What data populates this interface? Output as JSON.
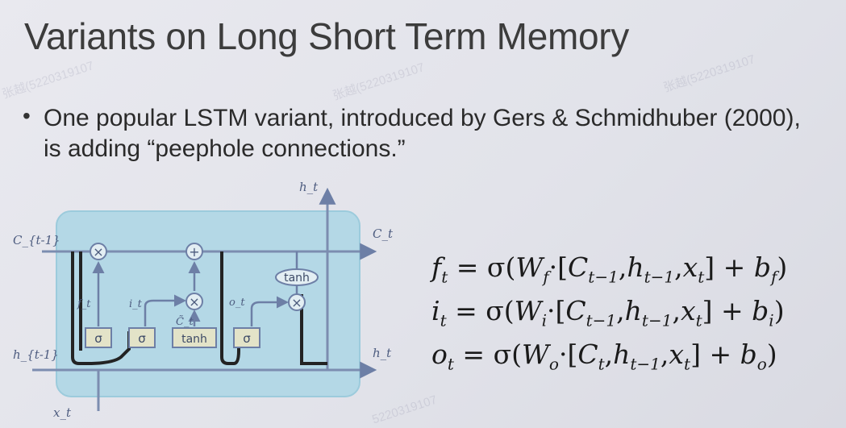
{
  "slide": {
    "title": "Variants on Long Short Term Memory",
    "bullet": "One popular LSTM variant, introduced by Gers & Schmidhuber (2000), is adding “peephole connections.”"
  },
  "diagram": {
    "labels": {
      "h_top": "h_t",
      "c_in": "C_{t-1}",
      "c_out": "C_t",
      "h_in": "h_{t-1}",
      "h_out": "h_t",
      "x_in": "x_t",
      "f": "f_t",
      "i": "i_t",
      "o": "o_t",
      "c_tilde": "C̃_t"
    },
    "ops": {
      "mult": "×",
      "add": "+",
      "tanh": "tanh"
    },
    "gates": [
      "σ",
      "σ",
      "tanh",
      "σ"
    ]
  },
  "equations": [
    {
      "lhs": "f",
      "weight": "f",
      "c": "t−1",
      "bias": "f"
    },
    {
      "lhs": "i",
      "weight": "i",
      "c": "t−1",
      "bias": "i"
    },
    {
      "lhs": "o",
      "weight": "o",
      "c": "t",
      "bias": "o"
    }
  ],
  "equation_text": {
    "eq_sign": "=",
    "sigma": "σ",
    "open": "(",
    "W": "W",
    "dot": "·",
    "open_bracket": "[",
    "C": "C",
    "h": "h",
    "x": "x",
    "t": "t",
    "h_sub": "t−1",
    "comma": ",",
    "close_bracket": "]",
    "plus": "+",
    "b": "b",
    "close": ")"
  },
  "watermarks": [
    "张越(5220319107",
    "张越(5220319107",
    "张越(5220319107",
    "5220319107"
  ]
}
